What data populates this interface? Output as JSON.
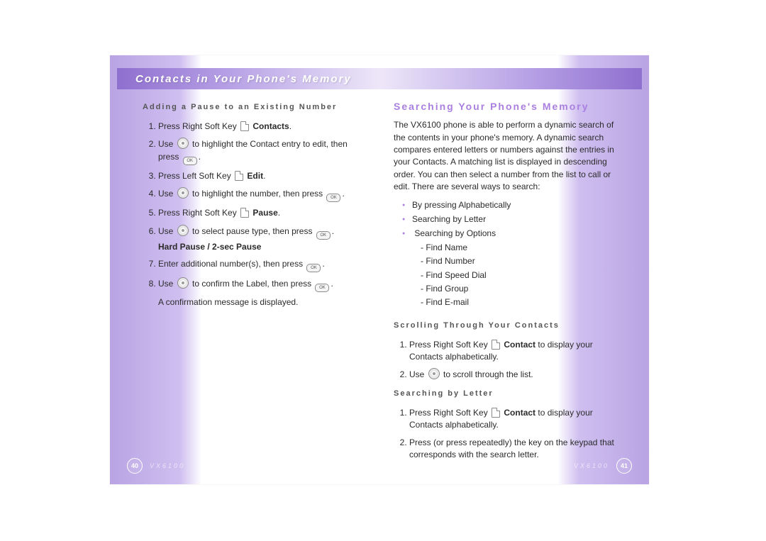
{
  "header": {
    "title": "Contacts in Your Phone's Memory"
  },
  "left": {
    "subhead": "Adding a Pause to an Existing Number",
    "steps": {
      "s1a": "Press Right Soft Key ",
      "s1b": "Contacts",
      "s1c": ".",
      "s2a": "Use ",
      "s2b": " to highlight the Contact entry to edit, then press ",
      "s2c": ".",
      "s3a": "Press Left Soft Key ",
      "s3b": "Edit",
      "s3c": ".",
      "s4a": "Use ",
      "s4b": " to highlight the number, then press ",
      "s4c": ".",
      "s5a": "Press Right Soft Key ",
      "s5b": "Pause",
      "s5c": ".",
      "s6a": "Use ",
      "s6b": " to select pause type, then press ",
      "s6c": ".",
      "s6d": "Hard Pause / 2-sec Pause",
      "s7a": "Enter additional number(s), then press ",
      "s7b": ".",
      "s8a": "Use ",
      "s8b": " to confirm the Label, then press ",
      "s8c": ".",
      "s8d": "A confirmation message is displayed."
    },
    "pagenum": "40",
    "model": "VX6100"
  },
  "right": {
    "section": "Searching Your Phone's Memory",
    "intro": "The VX6100 phone is able to perform a dynamic search of the contents in your phone's memory. A dynamic search compares entered letters or numbers against the entries in your Contacts. A matching list is displayed in descending order. You can then select a number from the list to call or edit. There are several ways to search:",
    "bullets": {
      "b1": "By pressing Alphabetically",
      "b2": "Searching by Letter",
      "b3": "Searching by Options",
      "o1": "- Find Name",
      "o2": "- Find Number",
      "o3": "- Find Speed Dial",
      "o4": "- Find Group",
      "o5": "- Find E-mail"
    },
    "scroll_head": "Scrolling Through Your Contacts",
    "scroll": {
      "s1a": "Press Right Soft Key ",
      "s1b": "Contact",
      "s1c": " to display your Contacts alphabetically.",
      "s2a": "Use ",
      "s2b": " to scroll through the list."
    },
    "letter_head": "Searching by Letter",
    "letter": {
      "s1a": "Press Right Soft Key ",
      "s1b": "Contact",
      "s1c": " to display your Contacts alphabetically.",
      "s2": "Press (or press repeatedly) the key on the keypad that corresponds with the search letter."
    },
    "pagenum": "41",
    "model": "VX6100"
  }
}
